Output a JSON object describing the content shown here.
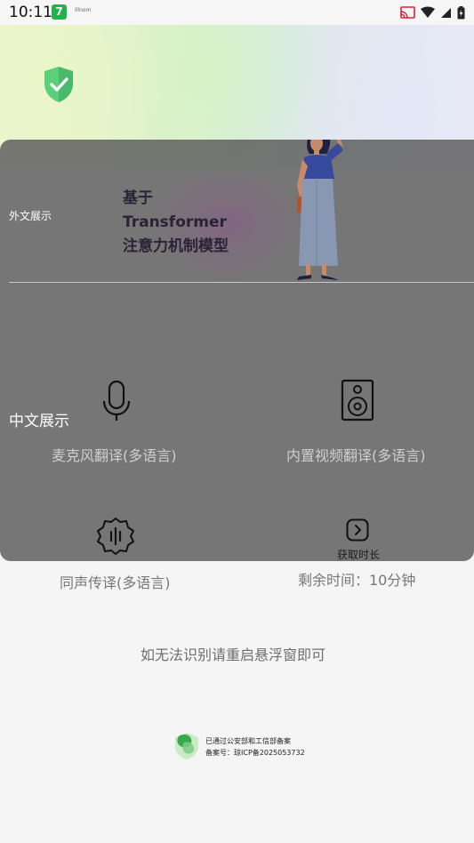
{
  "status_bar": {
    "time": "10:11",
    "app_badge": "7",
    "notification_text": "Illnom"
  },
  "overlay": {
    "foreign_label": "外文展示",
    "tagline": [
      "基于",
      "Transformer",
      "注意力机制模型"
    ],
    "chinese_label": "中文展示"
  },
  "features": {
    "mic": {
      "label": "麦克风翻译(多语言)",
      "icon": "microphone-icon"
    },
    "video": {
      "label": "内置视频翻译(多语言)",
      "icon": "speaker-icon"
    },
    "simultaneous": {
      "label": "同声传译(多语言)",
      "icon": "sound-wave-icon"
    },
    "get_time": {
      "label": "获取时长",
      "icon": "arrow-right-icon"
    }
  },
  "remaining_time": "剩余时间：10分钟",
  "hint": "如无法识别请重启悬浮窗即可",
  "footer": {
    "line1": "已通过公安部和工信部备案",
    "line2": "备案号：琼ICP备2025053732"
  },
  "colors": {
    "brand_green": "#22b14c",
    "overlay_gray": "#5a5a5a",
    "shield_green": "#5ccf7a"
  }
}
